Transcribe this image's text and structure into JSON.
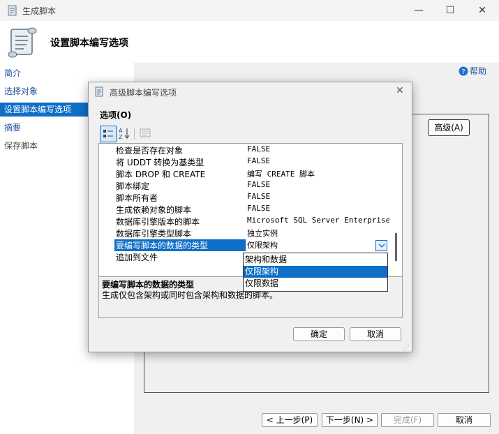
{
  "window": {
    "title": "生成脚本",
    "header_title": "设置脚本编写选项",
    "minimize": "—",
    "maximize": "☐",
    "close": "✕"
  },
  "nav": {
    "items": [
      {
        "label": "简介",
        "state": "normal"
      },
      {
        "label": "选择对象",
        "state": "normal"
      },
      {
        "label": "设置脚本编写选项",
        "state": "active"
      },
      {
        "label": "摘要",
        "state": "normal"
      },
      {
        "label": "保存脚本",
        "state": "disabled"
      }
    ]
  },
  "help_label": "帮助",
  "advanced_button_label": "高级(A)",
  "footer": {
    "prev_label": "< 上一步(P)",
    "next_label": "下一步(N) >",
    "finish_label": "完成(F)",
    "cancel_label": "取消"
  },
  "dialog": {
    "title": "高级脚本编写选项",
    "close": "✕",
    "options_label": "选项(O)",
    "rows": [
      {
        "name": "检查是否存在对象",
        "value": "FALSE"
      },
      {
        "name": "将 UDDT 转换为基类型",
        "value": "FALSE"
      },
      {
        "name": "脚本 DROP 和 CREATE",
        "value": "编写 CREATE 脚本"
      },
      {
        "name": "脚本绑定",
        "value": "FALSE"
      },
      {
        "name": "脚本所有者",
        "value": "FALSE"
      },
      {
        "name": "生成依赖对象的脚本",
        "value": "FALSE"
      },
      {
        "name": "数据库引擎版本的脚本",
        "value": "Microsoft SQL Server Enterprise Ed"
      },
      {
        "name": "数据库引擎类型脚本",
        "value": "独立实例"
      },
      {
        "name": "要编写脚本的数据的类型",
        "value": "仅限架构",
        "selected": true
      },
      {
        "name": "追加到文件",
        "value": ""
      }
    ],
    "dropdown_options": [
      {
        "label": "架构和数据",
        "selected": false
      },
      {
        "label": "仅限架构",
        "selected": true
      },
      {
        "label": "仅限数据",
        "selected": false
      }
    ],
    "description_title": "要编写脚本的数据的类型",
    "description_text": "生成仅包含架构或同时包含架构和数据的脚本。",
    "ok_label": "确定",
    "cancel_label": "取消"
  },
  "colors": {
    "accent": "#0f6fc6",
    "link": "#1f4e99"
  }
}
